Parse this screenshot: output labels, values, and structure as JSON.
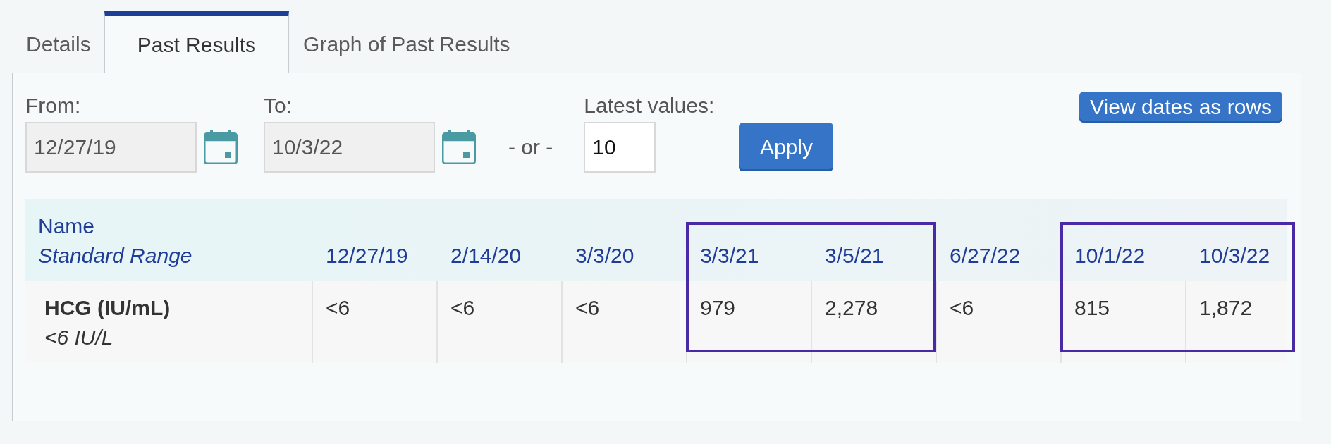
{
  "tabs": [
    {
      "label": "Details",
      "selected": false
    },
    {
      "label": "Past Results",
      "selected": true
    },
    {
      "label": "Graph of Past Results",
      "selected": false
    }
  ],
  "filters": {
    "fields": [
      {
        "kind": "date",
        "label": "From:",
        "value": "12/27/19",
        "disabled": true
      },
      {
        "kind": "date",
        "label": "To:",
        "value": "10/3/22",
        "disabled": true
      },
      {
        "kind": "separator",
        "text": "- or -"
      },
      {
        "kind": "count",
        "label": "Latest values:",
        "value": "10",
        "disabled": false
      }
    ],
    "apply_button": "Apply",
    "view_toggle_button": "View dates as rows"
  },
  "table": {
    "header": {
      "name": "Name",
      "range": "Standard Range"
    },
    "columns": [
      {
        "date": "12/27/19",
        "highlighted": false
      },
      {
        "date": "2/14/20",
        "highlighted": false
      },
      {
        "date": "3/3/20",
        "highlighted": false
      },
      {
        "date": "3/3/21",
        "highlighted": true
      },
      {
        "date": "3/5/21",
        "highlighted": true
      },
      {
        "date": "6/27/22",
        "highlighted": false
      },
      {
        "date": "10/1/22",
        "highlighted": true
      },
      {
        "date": "10/3/22",
        "highlighted": true
      }
    ],
    "rows": [
      {
        "name": "HCG (IU/mL)",
        "range": "<6 IU/L",
        "values": [
          "<6",
          "<6",
          "<6",
          "979",
          "2,278",
          "<6",
          "815",
          "1,872"
        ]
      }
    ]
  }
}
